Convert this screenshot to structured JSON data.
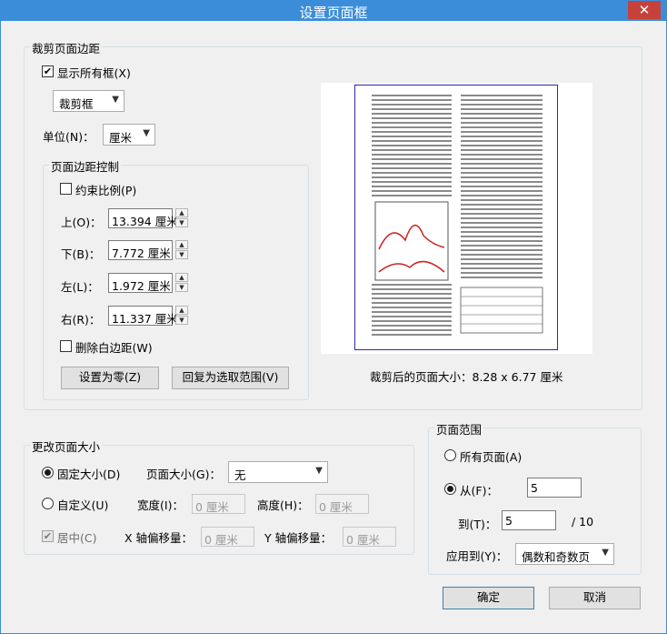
{
  "window": {
    "title": "设置页面框"
  },
  "crop": {
    "legend": "裁剪页面边距",
    "show_all_label": "显示所有框(X)",
    "show_all_checked": true,
    "box_select": "裁剪框",
    "unit_label": "单位(N)：",
    "unit_select": "厘米",
    "margin_group_legend": "页面边距控制",
    "constrain_label": "约束比例(P)",
    "constrain_checked": false,
    "top_label": "上(O)：",
    "top_value": "13.394 厘米",
    "bottom_label": "下(B)：",
    "bottom_value": "7.772 厘米",
    "left_label": "左(L)：",
    "left_value": "1.972 厘米",
    "right_label": "右(R)：",
    "right_value": "11.337 厘米",
    "remove_white_label": "删除白边距(W)",
    "remove_white_checked": false,
    "set_zero_button": "设置为零(Z)",
    "revert_button": "回复为选取范围(V)",
    "cropped_size_text": "裁剪后的页面大小：8.28 x 6.77 厘米"
  },
  "resize": {
    "legend": "更改页面大小",
    "fixed_label": "固定大小(D)",
    "fixed_selected": true,
    "page_size_label": "页面大小(G)：",
    "page_size_select": "无",
    "custom_label": "自定义(U)",
    "custom_selected": false,
    "width_label": "宽度(I)：",
    "width_value": "0 厘米",
    "height_label": "高度(H)：",
    "height_value": "0 厘米",
    "center_label": "居中(C)",
    "center_checked": true,
    "x_offset_label": "X 轴偏移量：",
    "x_offset_value": "0 厘米",
    "y_offset_label": "Y 轴偏移量：",
    "y_offset_value": "0 厘米"
  },
  "range": {
    "legend": "页面范围",
    "all_label": "所有页面(A)",
    "all_selected": false,
    "from_label": "从(F)：",
    "from_selected": true,
    "from_value": "5",
    "to_label": "到(T)：",
    "to_value": "5",
    "total_text": "/ 10",
    "apply_label": "应用到(Y)：",
    "apply_select": "偶数和奇数页"
  },
  "buttons": {
    "ok": "确定",
    "cancel": "取消"
  }
}
